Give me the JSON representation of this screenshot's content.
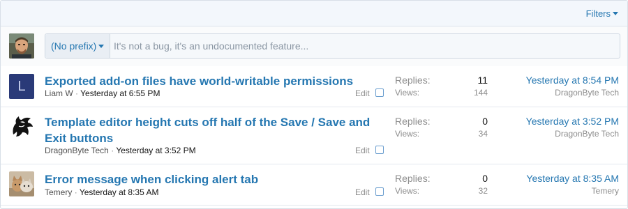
{
  "filter_bar": {
    "filters_label": "Filters"
  },
  "quick_thread": {
    "prefix_label": "(No prefix)",
    "title_placeholder": "It's not a bug, it's an undocumented feature..."
  },
  "threads": [
    {
      "avatar_letter": "L",
      "title": "Exported add-on files have world-writable permissions",
      "author": "Liam W",
      "separator": "·",
      "start_date": "Yesterday at 6:55 PM",
      "edit_label": "Edit",
      "replies_label": "Replies:",
      "replies": "11",
      "views_label": "Views:",
      "views": "144",
      "last_post_date": "Yesterday at 8:54 PM",
      "last_post_user": "DragonByte Tech"
    },
    {
      "avatar_icon": "dragon-icon",
      "title": "Template editor height cuts off half of the Save / Save and Exit buttons",
      "author": "DragonByte Tech",
      "separator": "·",
      "start_date": "Yesterday at 3:52 PM",
      "edit_label": "Edit",
      "replies_label": "Replies:",
      "replies": "0",
      "views_label": "Views:",
      "views": "34",
      "last_post_date": "Yesterday at 3:52 PM",
      "last_post_user": "DragonByte Tech"
    },
    {
      "avatar_icon": "cat-photo-avatar",
      "title": "Error message when clicking alert tab",
      "author": "Temery",
      "separator": "·",
      "start_date": "Yesterday at 8:35 AM",
      "edit_label": "Edit",
      "replies_label": "Replies:",
      "replies": "0",
      "views_label": "Views:",
      "views": "32",
      "last_post_date": "Yesterday at 8:35 AM",
      "last_post_user": "Temery"
    }
  ],
  "colors": {
    "link": "#2577b1",
    "muted": "#8c8c8c",
    "filter_bar_bg": "#f3f7fc"
  }
}
